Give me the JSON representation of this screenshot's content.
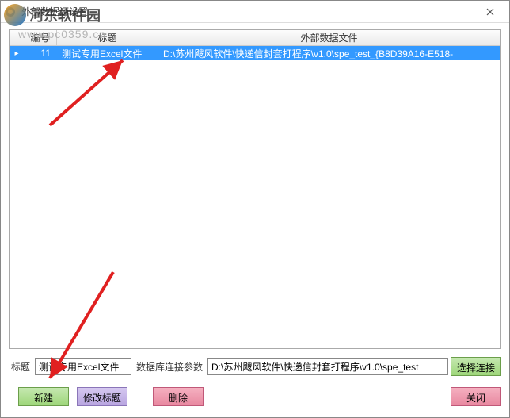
{
  "window": {
    "title": "外部数据源设置"
  },
  "table": {
    "headers": {
      "no": "编号",
      "title": "标题",
      "file": "外部数据文件"
    },
    "rows": [
      {
        "no": "11",
        "title": "测试专用Excel文件",
        "file": "D:\\苏州飕风软件\\快递信封套打程序\\v1.0\\spe_test_{B8D39A16-E518-"
      }
    ]
  },
  "form": {
    "title_label": "标题",
    "title_value": "测试专用Excel文件",
    "conn_label": "数据库连接参数",
    "conn_value": "D:\\苏州飕风软件\\快递信封套打程序\\v1.0\\spe_test"
  },
  "buttons": {
    "select_conn": "选择连接",
    "new": "新建",
    "edit_title": "修改标题",
    "delete": "删除",
    "close": "关闭"
  },
  "watermark": {
    "text": "河东软件园",
    "url": "www.pc0359.cn"
  }
}
